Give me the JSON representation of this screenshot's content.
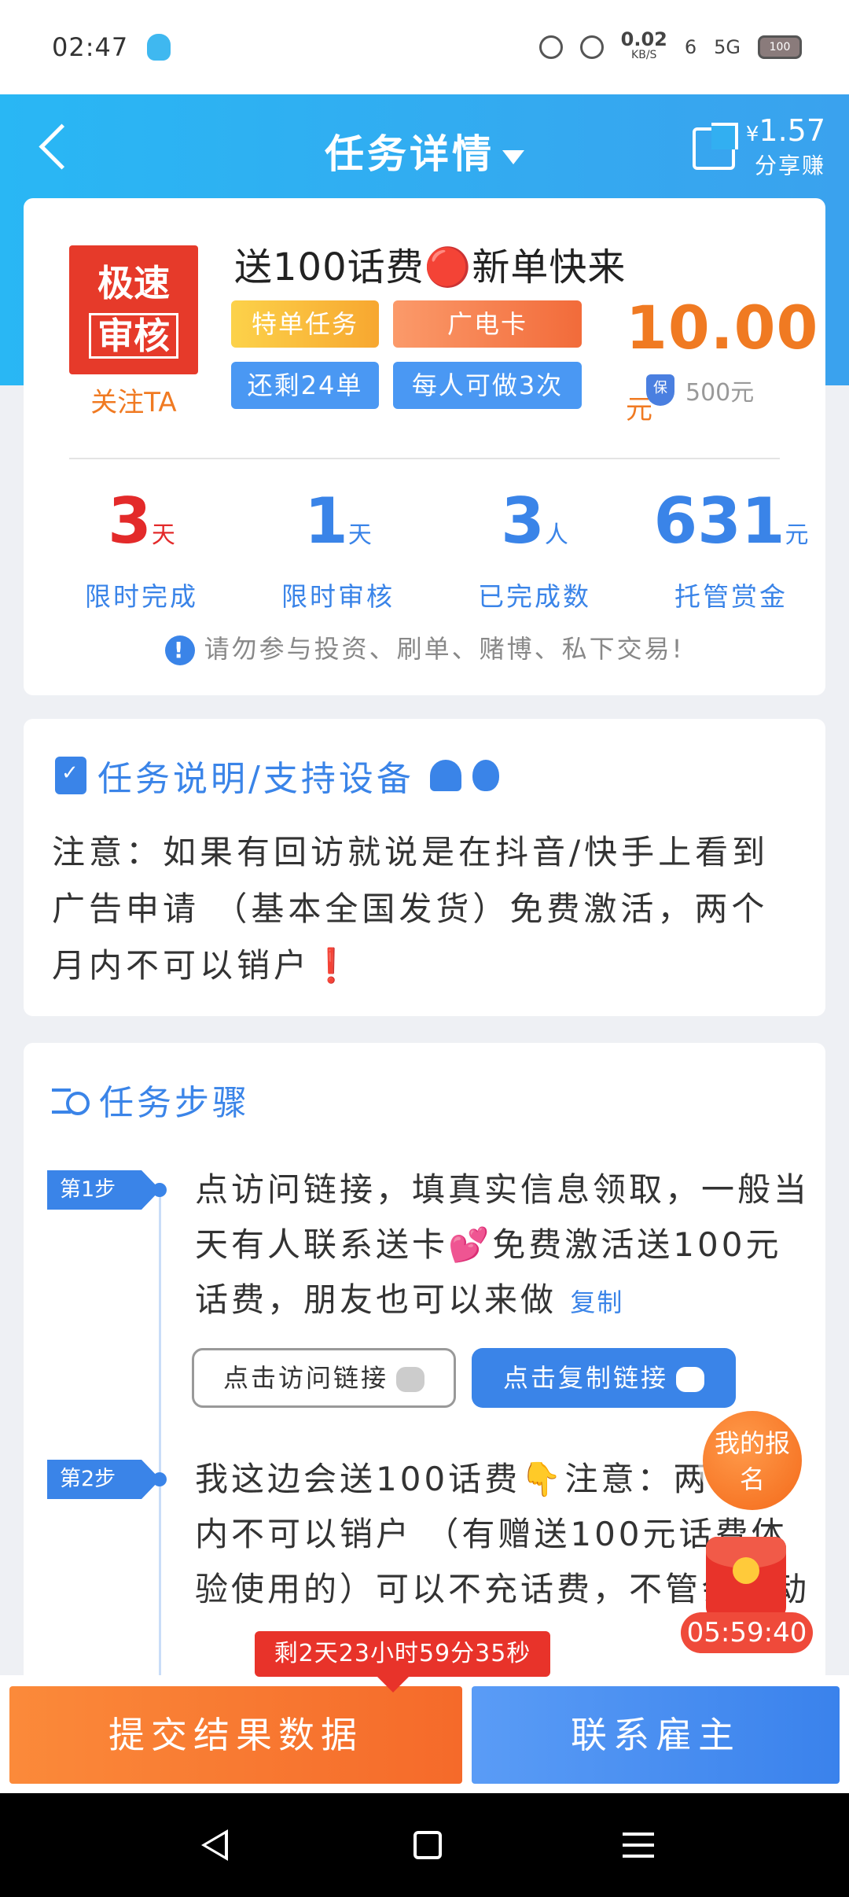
{
  "status": {
    "time": "02:47",
    "net_speed": "0.02",
    "net_unit": "KB/S",
    "sim": "6",
    "net_type": "5G",
    "battery": "100"
  },
  "nav": {
    "title": "任务详情",
    "share_currency": "¥",
    "share_amount": "1.57",
    "share_label": "分享赚"
  },
  "task": {
    "logo_line1": "极速",
    "logo_line2": "审核",
    "follow_label": "关注TA",
    "title": "送100话费🔴新单快来",
    "tags": [
      "特单任务",
      "广电卡",
      "还剩24单",
      "每人可做3次"
    ],
    "price": "10.00",
    "price_unit": "元",
    "deposit": "500元",
    "stats": [
      {
        "value": "3",
        "unit": "天",
        "label": "限时完成"
      },
      {
        "value": "1",
        "unit": "天",
        "label": "限时审核"
      },
      {
        "value": "3",
        "unit": "人",
        "label": "已完成数"
      },
      {
        "value": "631",
        "unit": "元",
        "label": "托管赏金"
      }
    ],
    "warning": "请勿参与投资、刷单、赌博、私下交易!"
  },
  "description": {
    "title": "任务说明/支持设备",
    "text": "注意：如果有回访就说是在抖音/快手上看到广告申请 （基本全国发货）免费激活，两个月内不可以销户",
    "mark": "❗"
  },
  "steps": {
    "title": "任务步骤",
    "items": [
      {
        "badge": "第1步",
        "text": "点访问链接，填真实信息领取，一般当天有人联系送卡💕免费激活送100元话费，朋友也可以来做",
        "copy": "复制"
      },
      {
        "badge": "第2步",
        "text": "我这边会送100话费👇注意：两个月内不可以销户 （有赠送100元话费体验使用的）可以不充话费，不管会自动"
      }
    ],
    "visit_button": "点击访问链接",
    "copy_button": "点击复制链接"
  },
  "floating": {
    "my_signup": "我的报名",
    "redpacket_timer": "05:59:40"
  },
  "bottom": {
    "countdown": "剩2天23小时59分35秒",
    "submit": "提交结果数据",
    "contact": "联系雇主"
  }
}
